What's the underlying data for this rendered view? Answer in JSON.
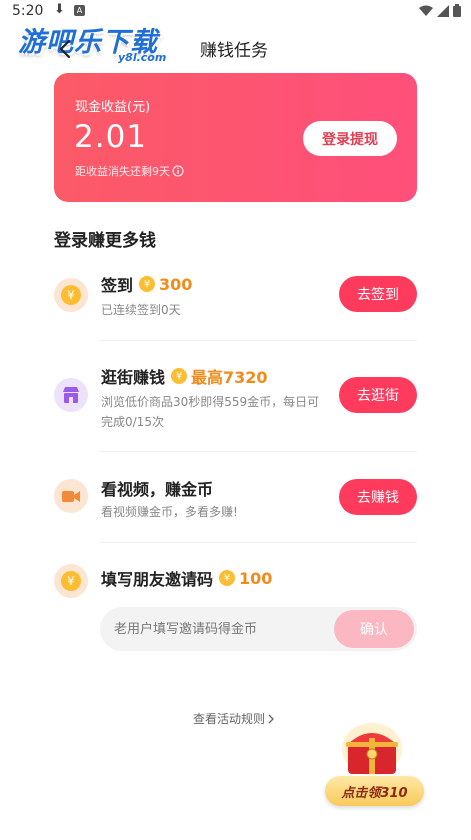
{
  "status_bar": {
    "time": "5:20"
  },
  "watermark": {
    "main": "游吧乐下载",
    "sub": "y8l.com"
  },
  "header": {
    "title": "赚钱任务"
  },
  "earnings": {
    "label": "现金收益(元)",
    "value": "2.01",
    "note": "距收益消失还剩9天",
    "button": "登录提现"
  },
  "section": {
    "title": "登录赚更多钱"
  },
  "tasks": [
    {
      "name": "签到",
      "reward": "300",
      "desc": "已连续签到0天",
      "button": "去签到",
      "icon": "yen-coin-icon"
    },
    {
      "name": "逛街赚钱",
      "reward": "最高7320",
      "desc": "浏览低价商品30秒即得559金币，每日可完成0/15次",
      "button": "去逛街",
      "icon": "shop-icon"
    },
    {
      "name": "看视频，赚金币",
      "reward": "",
      "desc": "看视频赚金币，多看多赚!",
      "button": "去赚钱",
      "icon": "video-icon"
    },
    {
      "name": "填写朋友邀请码",
      "reward": "100",
      "desc": "",
      "button": "",
      "icon": "yen-coin-icon"
    }
  ],
  "invite": {
    "placeholder": "老用户填写邀请码得金币",
    "confirm": "确认"
  },
  "rules": {
    "label": "查看活动规则"
  },
  "float_widget": {
    "label": "点击领310"
  },
  "colors": {
    "accent": "#ff3b5d",
    "card_gradient_start": "#fb5a67",
    "card_gradient_end": "#ff4f7b",
    "reward": "#f08c1b",
    "coin": "#fdbd33"
  }
}
